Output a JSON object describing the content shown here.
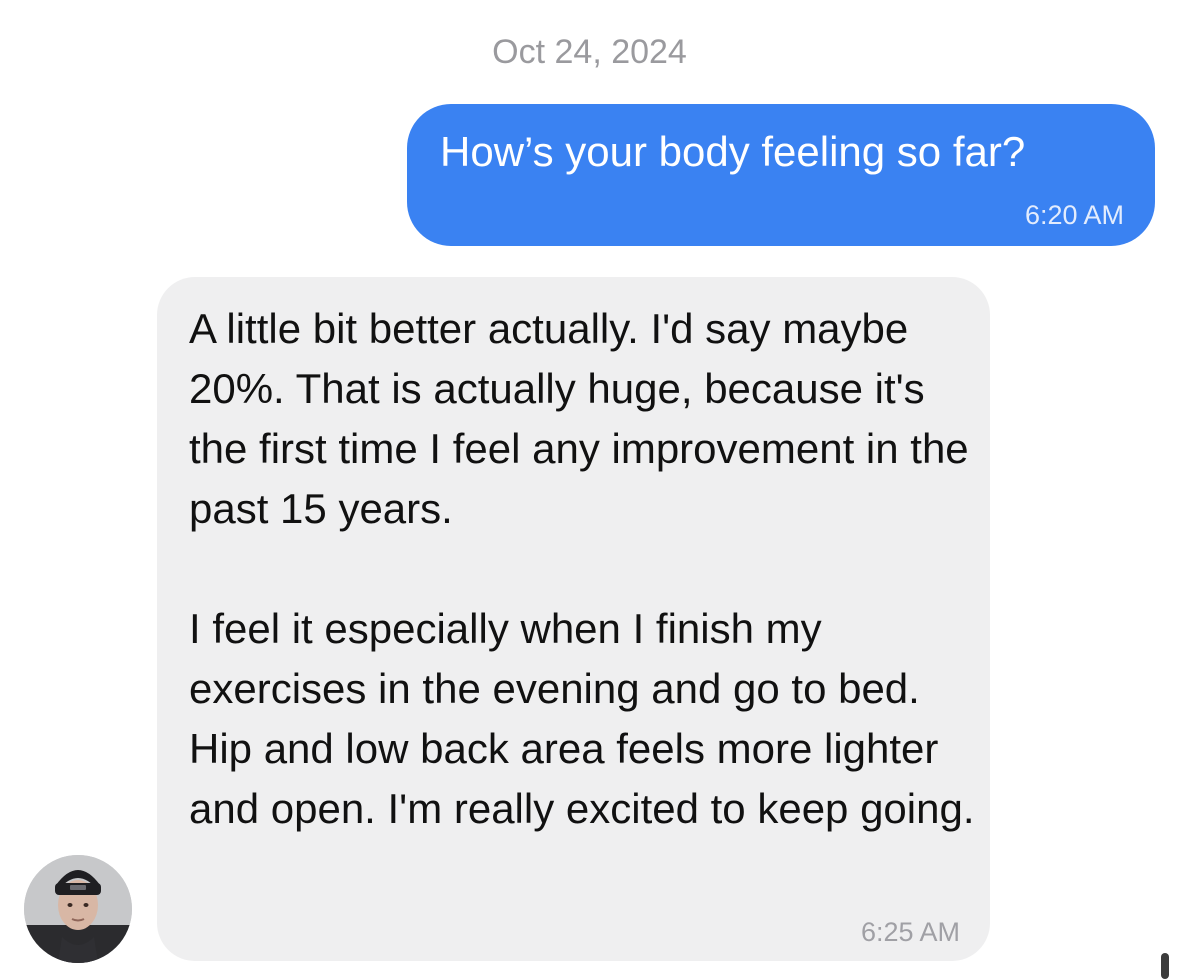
{
  "conversation": {
    "date_header": "Oct 24, 2024",
    "messages": [
      {
        "direction": "outgoing",
        "text": "How’s your body feeling so far?",
        "time": "6:20 AM"
      },
      {
        "direction": "incoming",
        "paragraphs": [
          "A little bit better actually. I'd say maybe 20%. That is actually huge, because it's the first time I feel any improvement in the past 15 years.",
          "I feel it especially when I finish my exercises in the evening and go to bed. Hip and low back area feels more lighter and open. I'm really excited to keep going."
        ],
        "time": "6:25 AM"
      }
    ]
  },
  "colors": {
    "outgoing_bubble": "#3a82f2",
    "incoming_bubble": "#efeff0",
    "timestamp_gray": "#9a9a9e"
  },
  "icons": {
    "avatar": "contact-avatar-photo"
  }
}
